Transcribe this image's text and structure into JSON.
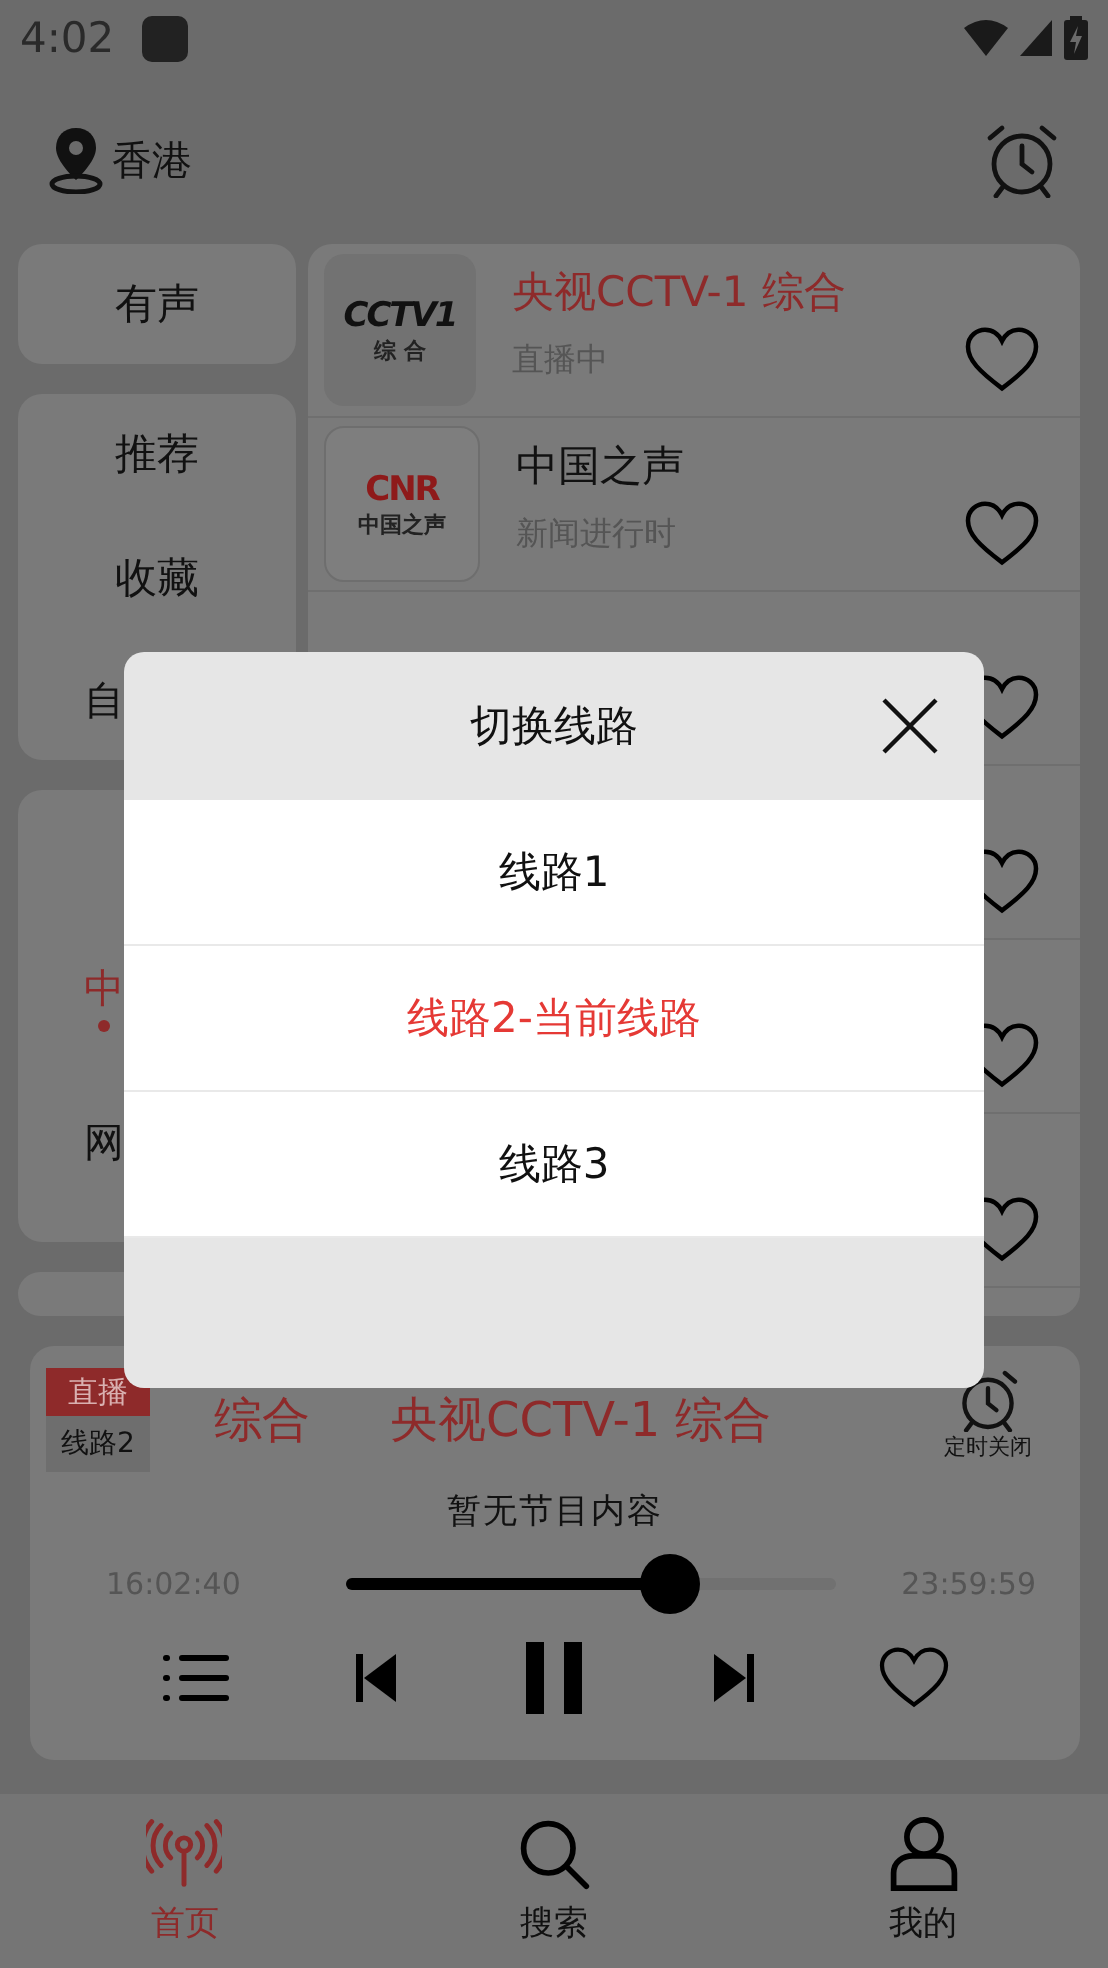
{
  "status_bar": {
    "time": "4:02"
  },
  "header": {
    "location": "香港"
  },
  "categories": [
    {
      "items": [
        {
          "label": "有声",
          "selected": false
        }
      ]
    },
    {
      "items": [
        {
          "label": "推荐",
          "selected": false
        },
        {
          "label": "收藏",
          "selected": false
        },
        {
          "label": "自",
          "selected": false
        }
      ]
    },
    {
      "items": [
        {
          "label": "中",
          "selected": true
        },
        {
          "label": "网",
          "selected": false
        }
      ]
    }
  ],
  "channels": [
    {
      "kind": "cctv",
      "logo": [
        "CCTV1",
        "综 合"
      ],
      "name": "央视CCTV-1 综合",
      "status": "直播中",
      "playing": true,
      "favorite": false
    },
    {
      "kind": "cnr",
      "logo": [
        "CNR",
        "中国之声"
      ],
      "name": "中国之声",
      "status": "新闻进行时",
      "playing": false,
      "favorite": false
    },
    {
      "kind": "covered",
      "favorite": false
    },
    {
      "kind": "covered",
      "favorite": false
    },
    {
      "kind": "covered",
      "favorite": false
    },
    {
      "kind": "covered",
      "favorite": false
    }
  ],
  "player": {
    "live_tag": "直播",
    "route_tag": "线路2",
    "marquee": [
      "综合",
      "央视CCTV-1 综合"
    ],
    "timer_label": "定时关闭",
    "program": "暂无节目内容",
    "elapsed": "16:02:40",
    "total": "23:59:59",
    "level": 0.66,
    "playing": true,
    "favorite": false
  },
  "nav": [
    {
      "kind": "radio",
      "label": "首页",
      "selected": true
    },
    {
      "kind": "search",
      "label": "搜索",
      "selected": false
    },
    {
      "kind": "user",
      "label": "我的",
      "selected": false
    }
  ],
  "dialog": {
    "title": "切换线路",
    "routes": [
      {
        "label": "线路1",
        "selected": false
      },
      {
        "label": "线路2-当前线路",
        "selected": true
      },
      {
        "label": "线路3",
        "selected": false
      }
    ]
  }
}
